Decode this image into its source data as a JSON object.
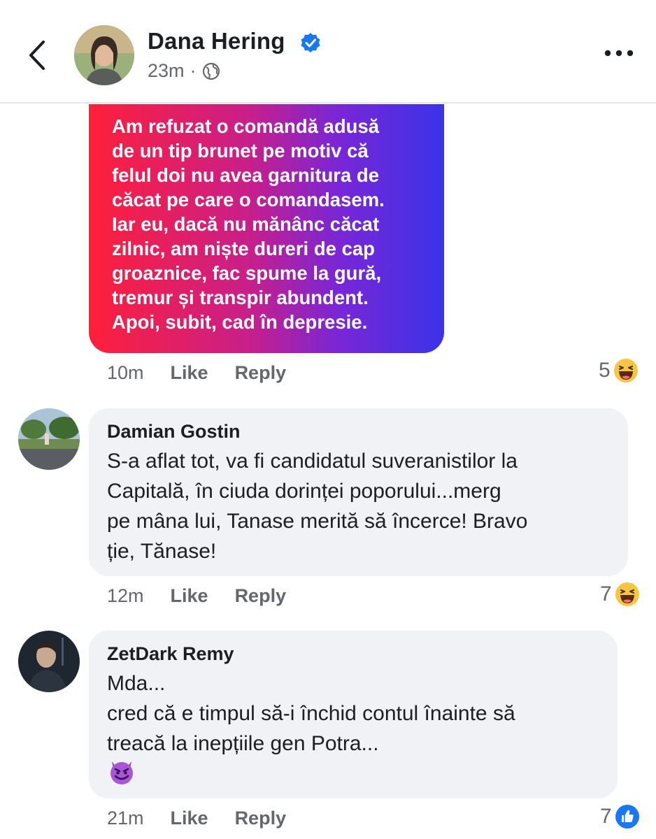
{
  "post": {
    "author_name": "Dana Hering",
    "time": "23m",
    "separator": "·"
  },
  "icons": {
    "back": "chevron-left-icon",
    "verified": "verified-badge-icon",
    "audience": "globe-icon",
    "more": "more-dots-icon",
    "reaction_haha": "haha-emoji-icon",
    "reaction_like": "like-icon",
    "devil": "smiling-devil-emoji"
  },
  "colors": {
    "gradient_start": "#ff1f3a",
    "gradient_end": "#3a33e8",
    "verified_blue": "#1877f2",
    "bubble_bg": "#f0f2f5",
    "meta_gray": "#65676b"
  },
  "comments": [
    {
      "type": "image-text",
      "text": "Am refuzat o comandă adusă\nde un tip brunet pe motiv că\nfelul doi nu avea garnitura de\ncăcat pe care o comandasem.\nIar eu, dacă nu mănânc căcat\nzilnic, am niște dureri de cap\ngroaznice, fac spume la gură,\ntremur și transpir abundent.\nApoi, subit, cad în depresie.",
      "time": "10m",
      "like_label": "Like",
      "reply_label": "Reply",
      "reaction_count": "5"
    },
    {
      "type": "text",
      "author": "Damian Gostin",
      "text": "S-a aflat tot, va fi candidatul suveranistilor la\nCapitală, în ciuda dorinței poporului...merg\npe mâna lui, Tanase merită să încerce! Bravo\nție,  Tănase!",
      "time": "12m",
      "like_label": "Like",
      "reply_label": "Reply",
      "reaction_count": "7"
    },
    {
      "type": "text",
      "author": "ZetDark Remy",
      "text": "Mda...\ncred că e timpul să-i închid contul înainte să\ntreacă la inepțiile gen Potra...",
      "emoji": "😈",
      "time": "21m",
      "like_label": "Like",
      "reply_label": "Reply",
      "reaction_count": "7"
    }
  ]
}
